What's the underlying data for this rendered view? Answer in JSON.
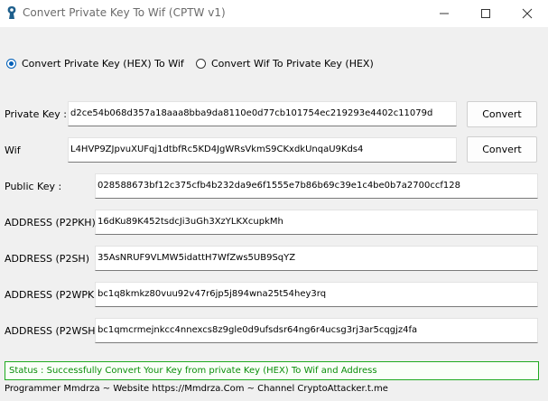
{
  "window": {
    "title": "Convert Private Key To Wif (CPTW v1)"
  },
  "modes": [
    {
      "label": "Convert Private Key (HEX) To Wif",
      "selected": true
    },
    {
      "label": "Convert Wif To Private Key (HEX)",
      "selected": false
    }
  ],
  "fields": {
    "private_key": {
      "label": "Private Key :",
      "value": "d2ce54b068d357a18aaa8bba9da8110e0d77cb101754ec219293e4402c11079d"
    },
    "wif": {
      "label": "Wif",
      "value": "L4HVP9ZJpvuXUFqj1dtbfRc5KD4JgWRsVkmS9CKxdkUnqaU9Kds4"
    },
    "public_key": {
      "label": "Public Key :",
      "value": "028588673bf12c375cfb4b232da9e6f1555e7b86b69c39e1c4be0b7a2700ccf128"
    },
    "p2pkh": {
      "label": "ADDRESS (P2PKH)",
      "value": "16dKu89K452tsdcJi3uGh3XzYLKXcupkMh"
    },
    "p2sh": {
      "label": "ADDRESS (P2SH)",
      "value": "35AsNRUF9VLMW5idattH7WfZws5UB9SqYZ"
    },
    "p2wpkh": {
      "label": "ADDRESS (P2WPKH)",
      "value": "bc1q8kmkz80vuu92v47r6jp5j894wna25t54hey3rq"
    },
    "p2wsh": {
      "label": "ADDRESS (P2WSH)",
      "value": "bc1qmcrmejnkcc4nnexcs8z9gle0d9ufsdsr64ng6r4ucsg3rj3ar5cqgjz4fa"
    }
  },
  "buttons": {
    "convert_private": "Convert",
    "convert_wif": "Convert"
  },
  "status": "Status : Successfully Convert Your Key from private Key (HEX) To Wif and Address",
  "footer": "Programmer Mmdrza ~ Website https://Mmdrza.Com ~ Channel CryptoAttacker.t.me",
  "colors": {
    "accent": "#005fb8",
    "status_green": "#0a8d0a",
    "status_border": "#1faa1f"
  }
}
